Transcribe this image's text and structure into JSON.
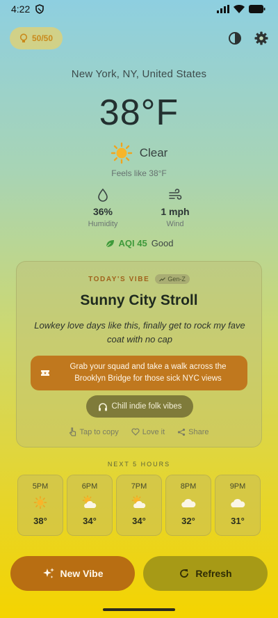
{
  "status_bar": {
    "time": "4:22"
  },
  "header": {
    "streak": "50/50"
  },
  "weather": {
    "location": "New York, NY, United States",
    "temperature": "38°F",
    "condition": "Clear",
    "feels_like": "Feels like 38°F",
    "humidity_value": "36%",
    "humidity_label": "Humidity",
    "wind_value": "1 mph",
    "wind_label": "Wind",
    "aqi_value": "AQI 45",
    "aqi_status": "Good"
  },
  "vibe": {
    "kicker": "TODAY'S VIBE",
    "badge": "Gen-Z",
    "title": "Sunny City Stroll",
    "description": "Lowkey love days like this, finally get to rock my fave coat with no cap",
    "activity": "Grab your squad and take a walk across the Brooklyn Bridge for those sick NYC views",
    "music": "Chill indie folk vibes",
    "actions": {
      "copy": "Tap to copy",
      "love": "Love it",
      "share": "Share"
    }
  },
  "hourly": {
    "title": "NEXT 5 HOURS",
    "hours": [
      {
        "time": "5PM",
        "icon": "sun-icon",
        "temp": "38°"
      },
      {
        "time": "6PM",
        "icon": "partly-cloudy-icon",
        "temp": "34°"
      },
      {
        "time": "7PM",
        "icon": "partly-cloudy-icon",
        "temp": "34°"
      },
      {
        "time": "8PM",
        "icon": "cloud-icon",
        "temp": "32°"
      },
      {
        "time": "9PM",
        "icon": "cloud-icon",
        "temp": "31°"
      }
    ]
  },
  "buttons": {
    "new_vibe": "New Vibe",
    "refresh": "Refresh"
  },
  "colors": {
    "accent_orange": "#c0781e",
    "aqi_good": "#3f9a3b",
    "refresh_olive": "#a79a16"
  }
}
